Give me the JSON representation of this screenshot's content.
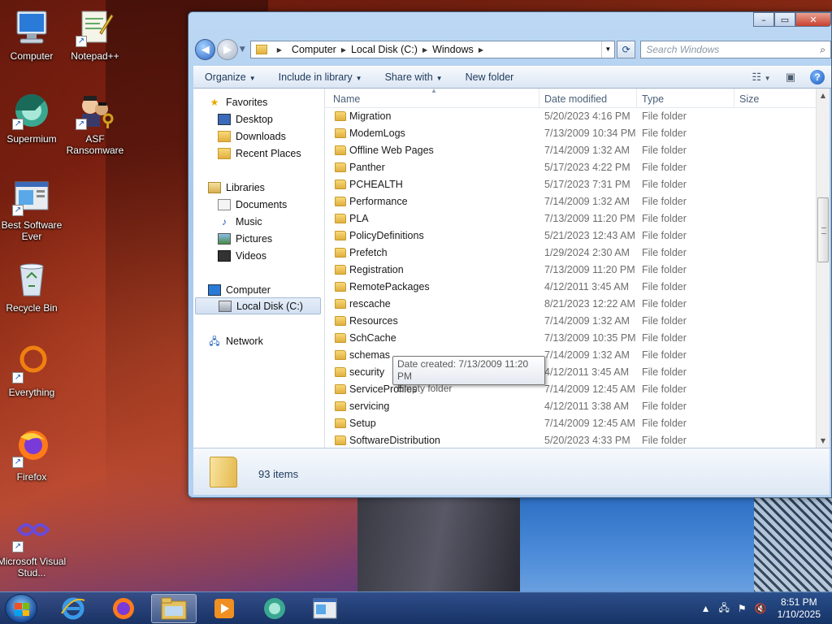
{
  "desktop": {
    "icons": [
      {
        "label": "Computer",
        "icon": "computer-icon"
      },
      {
        "label": "Notepad++",
        "icon": "notepadpp-icon"
      },
      {
        "label": "Supermium",
        "icon": "supermium-icon"
      },
      {
        "label": "ASF Ransomware",
        "icon": "asf-ransomware-icon"
      },
      {
        "label": "Best Software Ever",
        "icon": "best-software-icon"
      },
      {
        "label": "Recycle Bin",
        "icon": "recycle-bin-icon"
      },
      {
        "label": "Everything",
        "icon": "everything-icon"
      },
      {
        "label": "Firefox",
        "icon": "firefox-icon"
      },
      {
        "label": "Microsoft Visual Stud...",
        "icon": "visual-studio-icon"
      }
    ]
  },
  "explorer": {
    "address": [
      "Computer",
      "Local Disk (C:)",
      "Windows"
    ],
    "search_placeholder": "Search Windows",
    "toolbar": {
      "organize": "Organize",
      "include": "Include in library",
      "share": "Share with",
      "new_folder": "New folder"
    },
    "nav": {
      "favorites": "Favorites",
      "desktop": "Desktop",
      "downloads": "Downloads",
      "recent": "Recent Places",
      "libraries": "Libraries",
      "documents": "Documents",
      "music": "Music",
      "pictures": "Pictures",
      "videos": "Videos",
      "computer": "Computer",
      "local_disk": "Local Disk (C:)",
      "network": "Network"
    },
    "columns": {
      "name": "Name",
      "date": "Date modified",
      "type": "Type",
      "size": "Size"
    },
    "rows": [
      {
        "name": "Migration",
        "date": "5/20/2023 4:16 PM",
        "type": "File folder"
      },
      {
        "name": "ModemLogs",
        "date": "7/13/2009 10:34 PM",
        "type": "File folder"
      },
      {
        "name": "Offline Web Pages",
        "date": "7/14/2009 1:32 AM",
        "type": "File folder"
      },
      {
        "name": "Panther",
        "date": "5/17/2023 4:22 PM",
        "type": "File folder"
      },
      {
        "name": "PCHEALTH",
        "date": "5/17/2023 7:31 PM",
        "type": "File folder"
      },
      {
        "name": "Performance",
        "date": "7/14/2009 1:32 AM",
        "type": "File folder"
      },
      {
        "name": "PLA",
        "date": "7/13/2009 11:20 PM",
        "type": "File folder"
      },
      {
        "name": "PolicyDefinitions",
        "date": "5/21/2023 12:43 AM",
        "type": "File folder"
      },
      {
        "name": "Prefetch",
        "date": "1/29/2024 2:30 AM",
        "type": "File folder"
      },
      {
        "name": "Registration",
        "date": "7/13/2009 11:20 PM",
        "type": "File folder"
      },
      {
        "name": "RemotePackages",
        "date": "4/12/2011 3:45 AM",
        "type": "File folder"
      },
      {
        "name": "rescache",
        "date": "8/21/2023 12:22 AM",
        "type": "File folder"
      },
      {
        "name": "Resources",
        "date": "7/14/2009 1:32 AM",
        "type": "File folder"
      },
      {
        "name": "SchCache",
        "date": "7/13/2009 10:35 PM",
        "type": "File folder"
      },
      {
        "name": "schemas",
        "date": "7/14/2009 1:32 AM",
        "type": "File folder"
      },
      {
        "name": "security",
        "date": "4/12/2011 3:45 AM",
        "type": "File folder"
      },
      {
        "name": "ServiceProfiles",
        "date": "7/14/2009 12:45 AM",
        "type": "File folder"
      },
      {
        "name": "servicing",
        "date": "4/12/2011 3:38 AM",
        "type": "File folder"
      },
      {
        "name": "Setup",
        "date": "7/14/2009 12:45 AM",
        "type": "File folder"
      },
      {
        "name": "SoftwareDistribution",
        "date": "5/20/2023 4:33 PM",
        "type": "File folder"
      }
    ],
    "tooltip": {
      "line1": "Date created: 7/13/2009 11:20 PM",
      "line2": "Empty folder"
    },
    "status": "93 items"
  },
  "taskbar": {
    "apps": [
      "internet-explorer-icon",
      "firefox-icon",
      "explorer-icon",
      "media-player-icon",
      "supermium-icon",
      "best-software-icon"
    ],
    "time": "8:51 PM",
    "date": "1/10/2025"
  }
}
